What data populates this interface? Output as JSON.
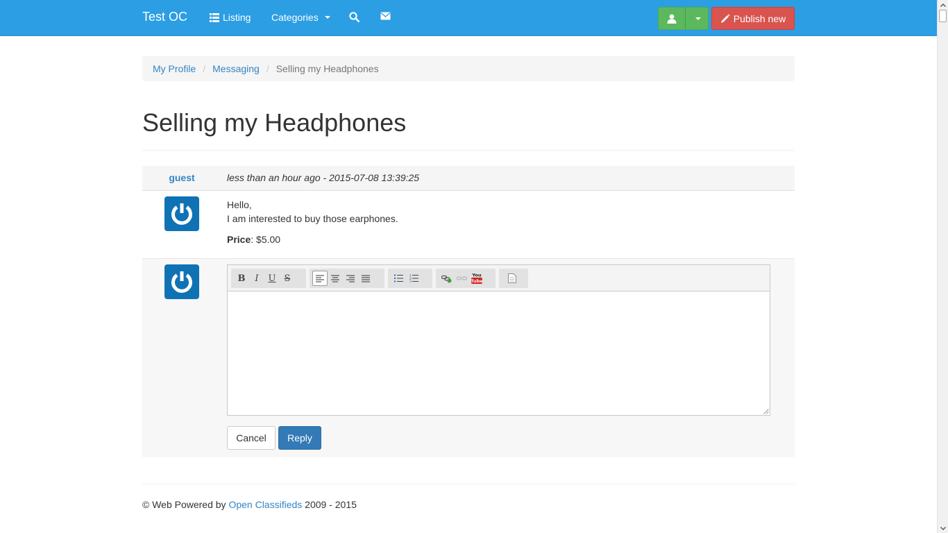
{
  "colors": {
    "navbar": "#2c9ee3",
    "link": "#3385c6",
    "success": "#5cb85c",
    "danger": "#d9534f",
    "primary": "#337ab7",
    "avatar": "#0f72b5"
  },
  "navbar": {
    "brand": "Test OC",
    "items": [
      {
        "label": "Listing",
        "icon": "list-icon"
      },
      {
        "label": "Categories",
        "icon": "caret-down-icon"
      },
      {
        "label": "",
        "icon": "search-icon"
      },
      {
        "label": "",
        "icon": "envelope-icon"
      }
    ],
    "user_button_icon": "user-icon",
    "publish_label": "Publish new",
    "publish_icon": "pencil-icon"
  },
  "breadcrumb": {
    "items": [
      "My Profile",
      "Messaging"
    ],
    "active": "Selling my Headphones"
  },
  "page": {
    "title": "Selling my Headphones"
  },
  "message": {
    "author": "guest",
    "date": "less than an hour ago - 2015-07-08 13:39:25",
    "lines": [
      "Hello,",
      "I am interested to buy those earphones."
    ],
    "price_label": "Price",
    "price_value": ": $5.00"
  },
  "editor": {
    "toolbar_groups": [
      [
        "bold",
        "italic",
        "underline",
        "strikethrough"
      ],
      [
        "align-left",
        "align-center",
        "align-right",
        "align-justify"
      ],
      [
        "bullet-list",
        "numbered-list"
      ],
      [
        "link",
        "unlink",
        "youtube"
      ],
      [
        "source"
      ]
    ],
    "bold_glyph": "B",
    "italic_glyph": "I",
    "underline_glyph": "U",
    "strike_glyph": "S",
    "youtube_top": "You",
    "youtube_bottom": "Tube",
    "value": ""
  },
  "actions": {
    "cancel_label": "Cancel",
    "reply_label": "Reply"
  },
  "footer": {
    "prefix": "© Web Powered by ",
    "link": "Open Classifieds",
    "suffix": " 2009 - 2015"
  }
}
